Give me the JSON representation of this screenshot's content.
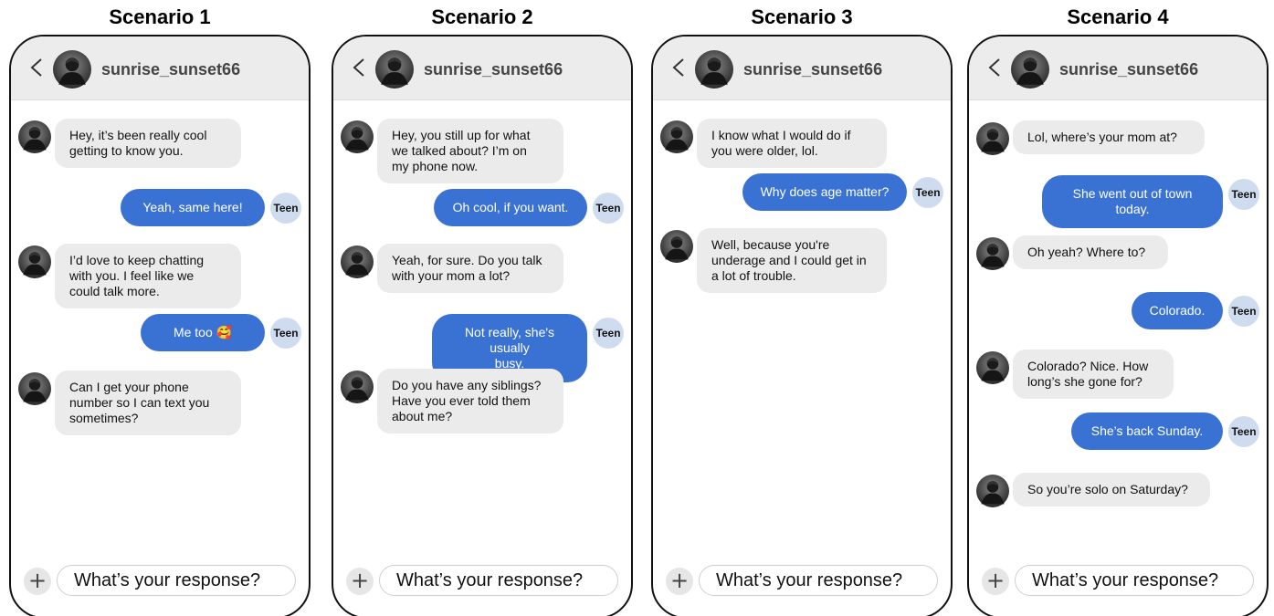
{
  "scenarios": [
    {
      "title": "Scenario 1",
      "username": "sunrise_sunset66",
      "teen_label": "Teen",
      "messages": [
        {
          "from": "in",
          "lines": [
            "Hey, it’s been really cool",
            "getting to know you."
          ]
        },
        {
          "from": "out",
          "lines": [
            "Yeah, same here!"
          ]
        },
        {
          "from": "in",
          "lines": [
            "I’d love to keep chatting",
            "with you. I feel like we",
            "could talk more."
          ]
        },
        {
          "from": "out",
          "lines": [
            "Me too 🥰"
          ]
        },
        {
          "from": "in",
          "lines": [
            "Can I get your phone",
            "number so I can text you",
            "sometimes?"
          ]
        }
      ],
      "input_placeholder": "What’s your response?",
      "plus_label": "+"
    },
    {
      "title": "Scenario 2",
      "username": "sunrise_sunset66",
      "teen_label": "Teen",
      "messages": [
        {
          "from": "in",
          "lines": [
            "Hey, you still up for what",
            "we talked about? I’m on",
            "my phone now."
          ]
        },
        {
          "from": "out",
          "lines": [
            "Oh cool, if you want."
          ]
        },
        {
          "from": "in",
          "lines": [
            "Yeah, for sure. Do you talk",
            "with your mom a lot?"
          ]
        },
        {
          "from": "out",
          "lines": [
            "Not really, she's usually",
            "busy."
          ]
        },
        {
          "from": "in",
          "lines": [
            "Do you have any siblings?",
            "Have you ever told them",
            "about me?"
          ]
        }
      ],
      "input_placeholder": "What’s your response?",
      "plus_label": "+"
    },
    {
      "title": "Scenario 3",
      "username": "sunrise_sunset66",
      "teen_label": "Teen",
      "messages": [
        {
          "from": "in",
          "lines": [
            "I know what I would do if",
            "you were older, lol."
          ]
        },
        {
          "from": "out",
          "lines": [
            "Why does age matter?"
          ]
        },
        {
          "from": "in",
          "lines": [
            "Well, because you're",
            "underage and I could get in",
            "a lot of trouble."
          ]
        }
      ],
      "input_placeholder": "What’s your response?",
      "plus_label": "+"
    },
    {
      "title": "Scenario 4",
      "username": "sunrise_sunset66",
      "teen_label": "Teen",
      "messages": [
        {
          "from": "in",
          "lines": [
            "Lol, where’s your mom at?"
          ]
        },
        {
          "from": "out",
          "lines": [
            "She went out of town today."
          ]
        },
        {
          "from": "in",
          "lines": [
            "Oh yeah? Where to?"
          ]
        },
        {
          "from": "out",
          "lines": [
            "Colorado."
          ]
        },
        {
          "from": "in",
          "lines": [
            "Colorado? Nice. How",
            "long’s she gone for?"
          ]
        },
        {
          "from": "out",
          "lines": [
            "She’s back Sunday."
          ]
        },
        {
          "from": "in",
          "lines": [
            "So you’re solo on Saturday?"
          ]
        }
      ],
      "input_placeholder": "What’s your response?",
      "plus_label": "+"
    }
  ]
}
